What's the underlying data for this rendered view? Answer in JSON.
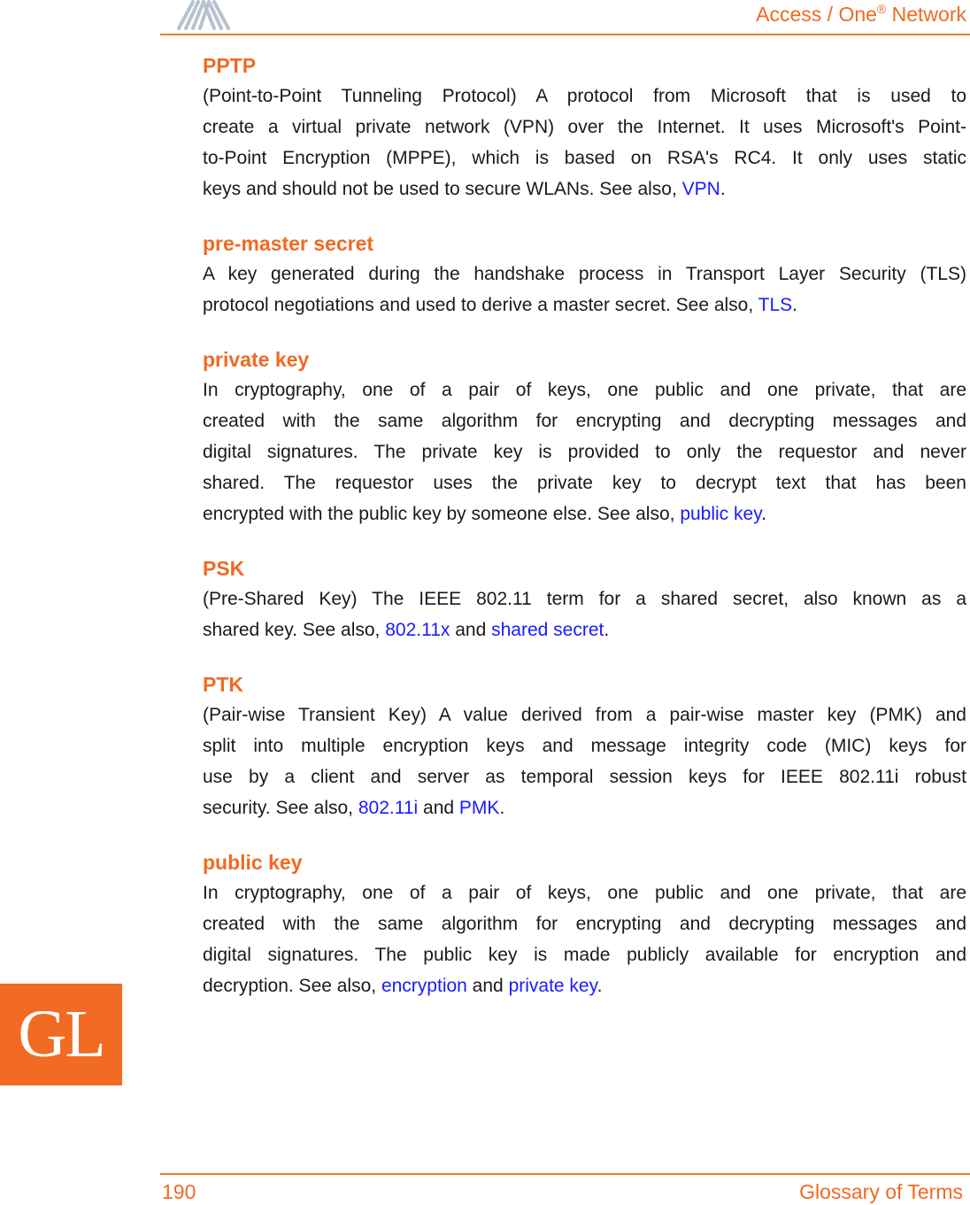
{
  "header": {
    "logo_icon": "brand-logo-icon",
    "title": "Access / One",
    "title_mark": "®",
    "title_suffix": " Network"
  },
  "side_tab": {
    "label": "GL"
  },
  "footer": {
    "page_number": "190",
    "section": "Glossary of Terms"
  },
  "entries": [
    {
      "term": "PPTP",
      "lines": [
        [
          {
            "t": "(Point-to-Point Tunneling Protocol) A protocol from Microsoft that is used to"
          }
        ],
        [
          {
            "t": "create a virtual private network (VPN) over the Internet. It uses Microsoft's Point-"
          }
        ],
        [
          {
            "t": "to-Point Encryption (MPPE), which is based on RSA's RC4. It only uses static"
          }
        ],
        [
          {
            "t": "keys and should not be used to secure WLANs. See also, "
          },
          {
            "t": "VPN",
            "link": true
          },
          {
            "t": "."
          }
        ]
      ]
    },
    {
      "term": "pre-master secret",
      "lines": [
        [
          {
            "t": "A key generated during the handshake process in Transport Layer Security (TLS)"
          }
        ],
        [
          {
            "t": "protocol negotiations and used to derive a master secret. See also, "
          },
          {
            "t": "TLS",
            "link": true
          },
          {
            "t": "."
          }
        ]
      ]
    },
    {
      "term": "private key",
      "lines": [
        [
          {
            "t": "In cryptography, one of a pair of keys, one public and one private, that are"
          }
        ],
        [
          {
            "t": "created with the same algorithm for encrypting and decrypting messages and"
          }
        ],
        [
          {
            "t": "digital signatures. The private key is provided to only the requestor and never"
          }
        ],
        [
          {
            "t": "shared. The requestor uses the private key to decrypt text that has been"
          }
        ],
        [
          {
            "t": "encrypted with the public key by someone else. See also, "
          },
          {
            "t": "public key",
            "link": true
          },
          {
            "t": "."
          }
        ]
      ]
    },
    {
      "term": "PSK",
      "lines": [
        [
          {
            "t": "(Pre-Shared Key) The IEEE 802.11 term for a shared secret, also known as a"
          }
        ],
        [
          {
            "t": "shared key. See also, "
          },
          {
            "t": "802.11x",
            "link": true
          },
          {
            "t": " and "
          },
          {
            "t": "shared secret",
            "link": true
          },
          {
            "t": "."
          }
        ]
      ]
    },
    {
      "term": "PTK",
      "lines": [
        [
          {
            "t": "(Pair-wise Transient Key) A value derived from a pair-wise master key (PMK) and"
          }
        ],
        [
          {
            "t": "split into multiple encryption keys and message integrity code (MIC) keys for"
          }
        ],
        [
          {
            "t": "use by a client and server as temporal session keys for IEEE 802.11i robust"
          }
        ],
        [
          {
            "t": "security. See also, "
          },
          {
            "t": "802.11i",
            "link": true
          },
          {
            "t": " and "
          },
          {
            "t": "PMK",
            "link": true
          },
          {
            "t": "."
          }
        ]
      ]
    },
    {
      "term": "public key",
      "lines": [
        [
          {
            "t": "In cryptography, one of a pair of keys, one public and one private, that are"
          }
        ],
        [
          {
            "t": "created with the same algorithm for encrypting and decrypting messages and"
          }
        ],
        [
          {
            "t": "digital signatures. The public key is made publicly available for encryption and"
          }
        ],
        [
          {
            "t": "decryption. See also, "
          },
          {
            "t": "encryption",
            "link": true
          },
          {
            "t": " and "
          },
          {
            "t": "private key",
            "link": true
          },
          {
            "t": "."
          }
        ]
      ]
    }
  ],
  "colors": {
    "accent": "#f06a22",
    "link": "#1a1aff",
    "text": "#1a1a1a"
  }
}
